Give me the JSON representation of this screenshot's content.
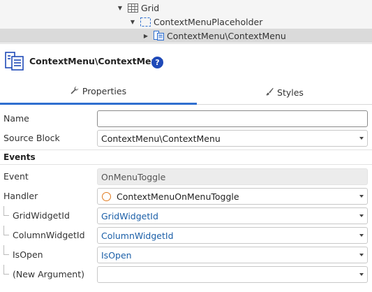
{
  "tree": {
    "items": [
      {
        "label": "Grid",
        "icon": "grid-icon",
        "expanded": true
      },
      {
        "label": "ContextMenuPlaceholder",
        "icon": "placeholder-icon",
        "expanded": true
      },
      {
        "label": "ContextMenu\\ContextMenu",
        "icon": "block-icon",
        "expanded": false,
        "selected": true
      }
    ]
  },
  "header": {
    "title": "ContextMenu\\ContextMenu",
    "help": "?"
  },
  "tabs": [
    {
      "label": "Properties",
      "icon": "wrench-icon",
      "active": true
    },
    {
      "label": "Styles",
      "icon": "brush-icon",
      "active": false
    }
  ],
  "properties": {
    "name_label": "Name",
    "name_value": "",
    "source_block_label": "Source Block",
    "source_block_value": "ContextMenu\\ContextMenu",
    "events_title": "Events",
    "event_label": "Event",
    "event_value": "OnMenuToggle",
    "handler_label": "Handler",
    "handler_value": "ContextMenuOnMenuToggle",
    "arguments": [
      {
        "label": "GridWidgetId",
        "value": "GridWidgetId"
      },
      {
        "label": "ColumnWidgetId",
        "value": "ColumnWidgetId"
      },
      {
        "label": "IsOpen",
        "value": "IsOpen"
      },
      {
        "label": "(New Argument)",
        "value": ""
      }
    ]
  },
  "colors": {
    "accent": "#2f6fcf",
    "help_bg": "#1f4ab8",
    "link": "#1b5fa8",
    "handler_circle": "#e07a1f",
    "selected_row": "#dadada"
  }
}
